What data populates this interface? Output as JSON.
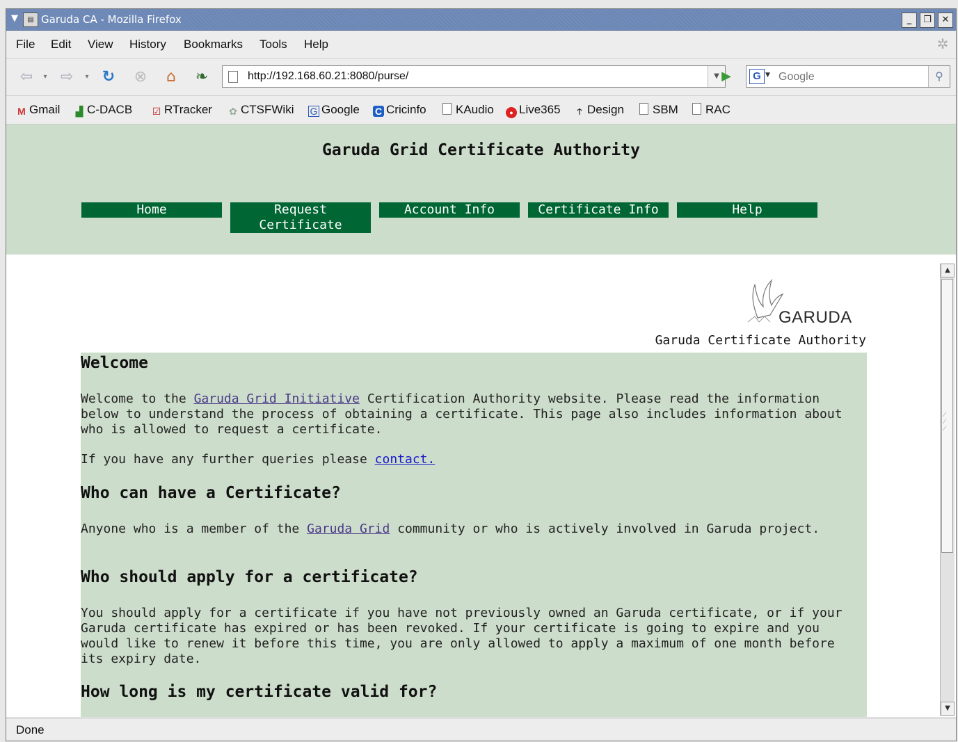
{
  "window": {
    "title": "Garuda CA - Mozilla Firefox"
  },
  "menubar": {
    "items": [
      {
        "label": "File"
      },
      {
        "label": "Edit"
      },
      {
        "label": "View"
      },
      {
        "label": "History"
      },
      {
        "label": "Bookmarks"
      },
      {
        "label": "Tools"
      },
      {
        "label": "Help"
      }
    ]
  },
  "navbar": {
    "url": "http://192.168.60.21:8080/purse/",
    "search_placeholder": "Google",
    "search_engine": "G",
    "icons": [
      "back-icon",
      "forward-icon",
      "reload-icon",
      "stop-icon",
      "home-icon",
      "leaf-icon",
      "go-icon",
      "search-icon"
    ]
  },
  "bookmarks": [
    {
      "label": "Gmail",
      "icon": "gmail-icon"
    },
    {
      "label": "C-DACB",
      "icon": "chart-icon"
    },
    {
      "label": "RTracker",
      "icon": "check-icon"
    },
    {
      "label": "CTSFWiki",
      "icon": "wiki-icon"
    },
    {
      "label": "Google",
      "icon": "google-icon"
    },
    {
      "label": "Cricinfo",
      "icon": "cricinfo-icon"
    },
    {
      "label": "KAudio",
      "icon": "page-icon"
    },
    {
      "label": "Live365",
      "icon": "live365-icon"
    },
    {
      "label": "Design",
      "icon": "design-icon"
    },
    {
      "label": "SBM",
      "icon": "page-icon"
    },
    {
      "label": "RAC",
      "icon": "page-icon"
    }
  ],
  "page": {
    "site_title": "Garuda Grid Certificate Authority",
    "tabs": [
      {
        "line1": "Home",
        "line2": ""
      },
      {
        "line1": "Request",
        "line2": "Certificate"
      },
      {
        "line1": "Account Info",
        "line2": ""
      },
      {
        "line1": "Certificate Info",
        "line2": ""
      },
      {
        "line1": "Help",
        "line2": ""
      }
    ],
    "logo_text": "GARUDA",
    "logo_caption": "Garuda Certificate Authority",
    "welcome": {
      "heading": "Welcome",
      "p1_pre": "Welcome to the ",
      "p1_link": "Garuda Grid Initiative",
      "p1_post": " Certification Authority website. Please read the information below to understand the process of obtaining a certificate. This page also includes information about who is allowed to request a certificate.",
      "p2_pre": "If you have any further queries please ",
      "p2_link": "contact."
    },
    "who": {
      "heading": "Who can have a Certificate?",
      "p_pre": "Anyone who is a member of the ",
      "p_link": "Garuda Grid",
      "p_post": " community or who is actively involved in Garuda project."
    },
    "apply": {
      "heading": "Who should apply for a certificate?",
      "p": "You should apply for a certificate if you have not previously owned an Garuda certificate, or if your Garuda certificate has expired or has been revoked. If your certificate is going to expire and you would like to renew it before this time, you are only allowed to apply a maximum of one month before its expiry date."
    },
    "valid": {
      "heading": "How long is my certificate valid for?"
    }
  },
  "status": {
    "text": "Done"
  }
}
